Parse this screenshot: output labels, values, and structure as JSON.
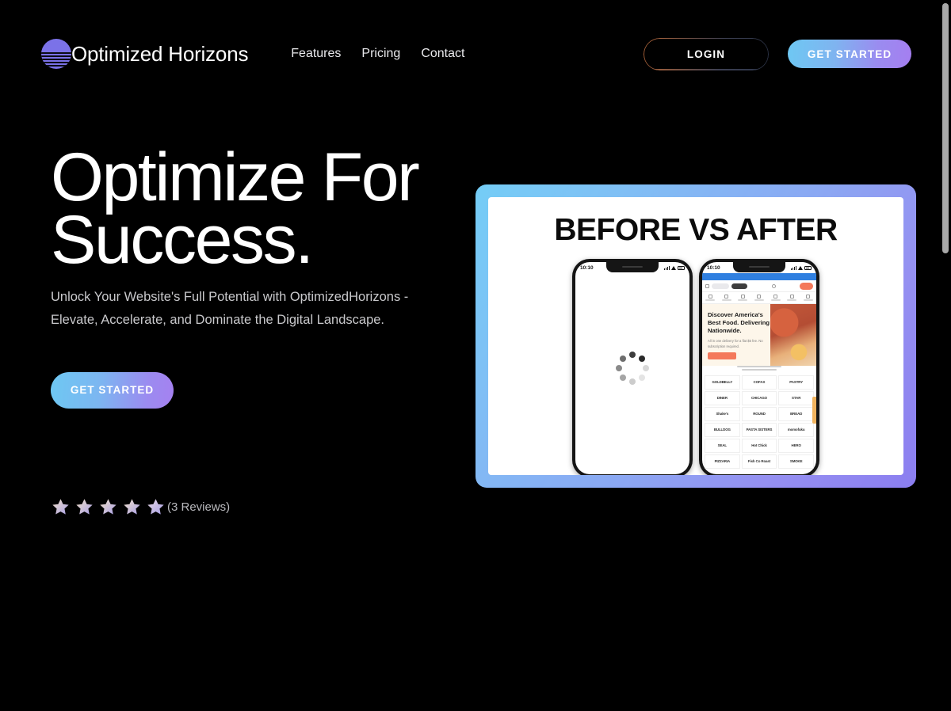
{
  "brand": {
    "name": "Optimized Horizons",
    "logo_icon": "horizon-sunset-circle-icon"
  },
  "nav": {
    "items": [
      {
        "label": "Features"
      },
      {
        "label": "Pricing"
      },
      {
        "label": "Contact"
      }
    ]
  },
  "header_actions": {
    "login_label": "LOGIN",
    "get_started_label": "GET STARTED"
  },
  "hero": {
    "title_line1": "Optimize For",
    "title_line2": "Success.",
    "subtitle": "Unlock Your Website's Full Potential with OptimizedHorizons - Elevate, Accelerate, and Dominate the Digital Landscape.",
    "cta_label": "GET STARTED"
  },
  "reviews": {
    "stars_filled": 5,
    "count_label": "(3 Reviews)"
  },
  "showcase": {
    "title": "BEFORE VS AFTER",
    "before_phone": {
      "status_time": "10:10",
      "state": "loading-spinner"
    },
    "after_phone": {
      "status_time": "10:10",
      "headline": "Discover America's Best Food. Delivering Nationwide.",
      "subtext": "All in one delivery for a flat $5 fee. No subscription required.",
      "cta_label": "Learn More",
      "logos_caption_line1": "MIX & MATCH FROM ICONIC",
      "logos_caption_line2": "RESTAURANTS & BAKERIES",
      "brand_logos": [
        "GOLDBELLY",
        "COFAX",
        "PASTRY",
        "DINER",
        "CHICAGO",
        "STAR",
        "Shake's",
        "ROUND",
        "BREAD",
        "BULLDOG",
        "PASTA SISTERS",
        "momofuku",
        "SEAL",
        "Hot Chick",
        "HERO",
        "PIZZARIA",
        "Fish Co Roast",
        "SMOKE"
      ]
    }
  },
  "colors": {
    "background": "#000000",
    "accent_cyan": "#6ec8f3",
    "accent_purple": "#8b7ef0",
    "login_border_start": "#b5673a",
    "login_border_end": "#2b3347",
    "star_gradient_start": "#f0ddc2",
    "star_gradient_end": "#a9a0e6",
    "food_orange": "#f4795b"
  },
  "scrollbar": {
    "position": "top"
  }
}
